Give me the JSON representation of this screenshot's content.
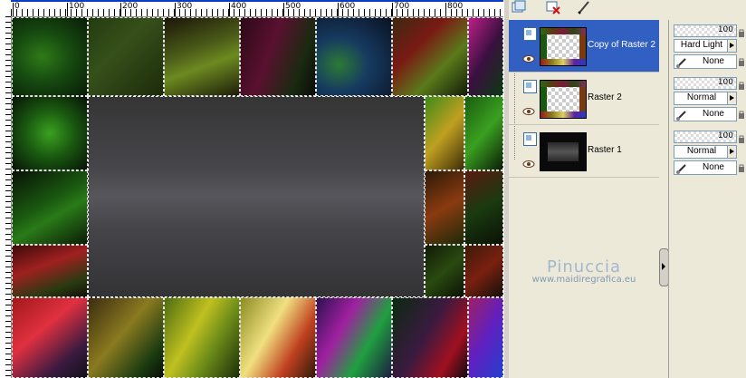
{
  "ruler": {
    "labels": [
      "0",
      "100",
      "200",
      "300",
      "400",
      "500",
      "600",
      "700",
      "800"
    ]
  },
  "layers": [
    {
      "name": "Copy of Raster 2",
      "opacity": "100",
      "blend_mode": "Hard Light",
      "mask": "None",
      "selected": true
    },
    {
      "name": "Raster 2",
      "opacity": "100",
      "blend_mode": "Normal",
      "mask": "None",
      "selected": false
    },
    {
      "name": "Raster 1",
      "opacity": "100",
      "blend_mode": "Normal",
      "mask": "None",
      "selected": false
    }
  ],
  "watermark": {
    "title": "Pinuccia",
    "url": "www.maidiregrafica.eu"
  },
  "colors": {
    "selection": "#3160c2",
    "palette_bg": "#ece9d8",
    "ruler_line": "#0a3cc4"
  },
  "icons": [
    "new-layer-icon",
    "delete-layer-icon",
    "edit-layer-icon",
    "raster-layer-icon",
    "eye-icon",
    "mask-brush-icon",
    "lock-icon"
  ]
}
